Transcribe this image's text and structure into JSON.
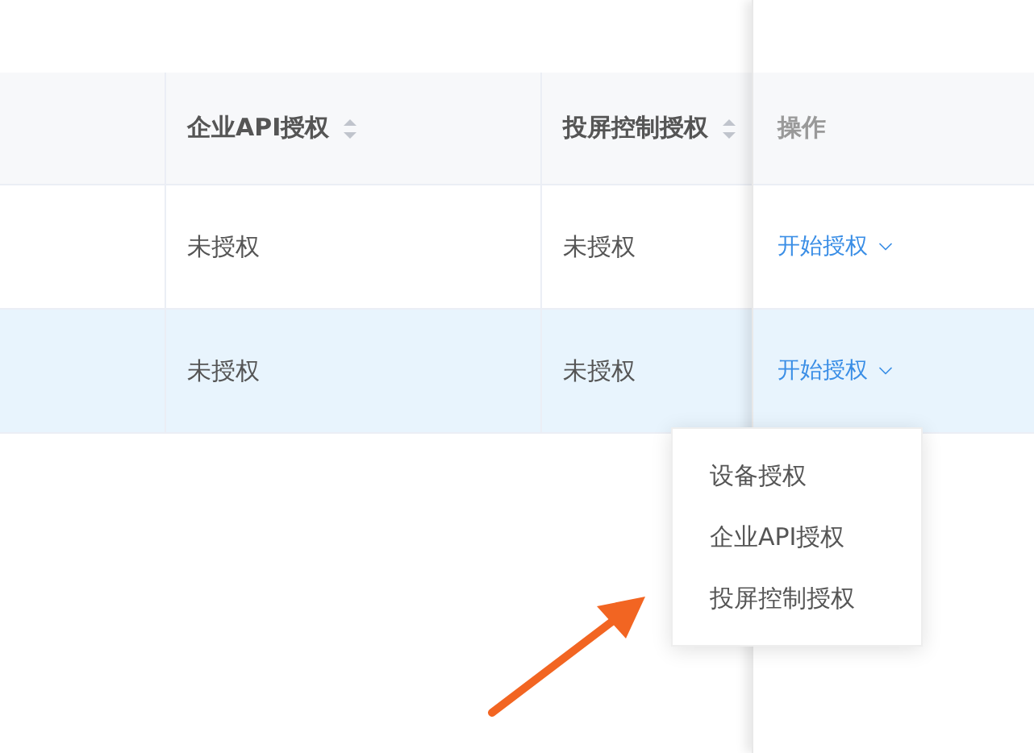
{
  "table": {
    "columns": [
      {
        "label": "企业API授权",
        "sortable": true
      },
      {
        "label": "投屏控制授权",
        "sortable": true
      }
    ],
    "action_column": {
      "label": "操作"
    },
    "rows": [
      {
        "cells": [
          "未授权",
          "未授权"
        ],
        "action": "开始授权",
        "selected": false
      },
      {
        "cells": [
          "未授权",
          "未授权"
        ],
        "action": "开始授权",
        "selected": true
      }
    ]
  },
  "dropdown_menu": {
    "items": [
      "设备授权",
      "企业API授权",
      "投屏控制授权"
    ]
  }
}
